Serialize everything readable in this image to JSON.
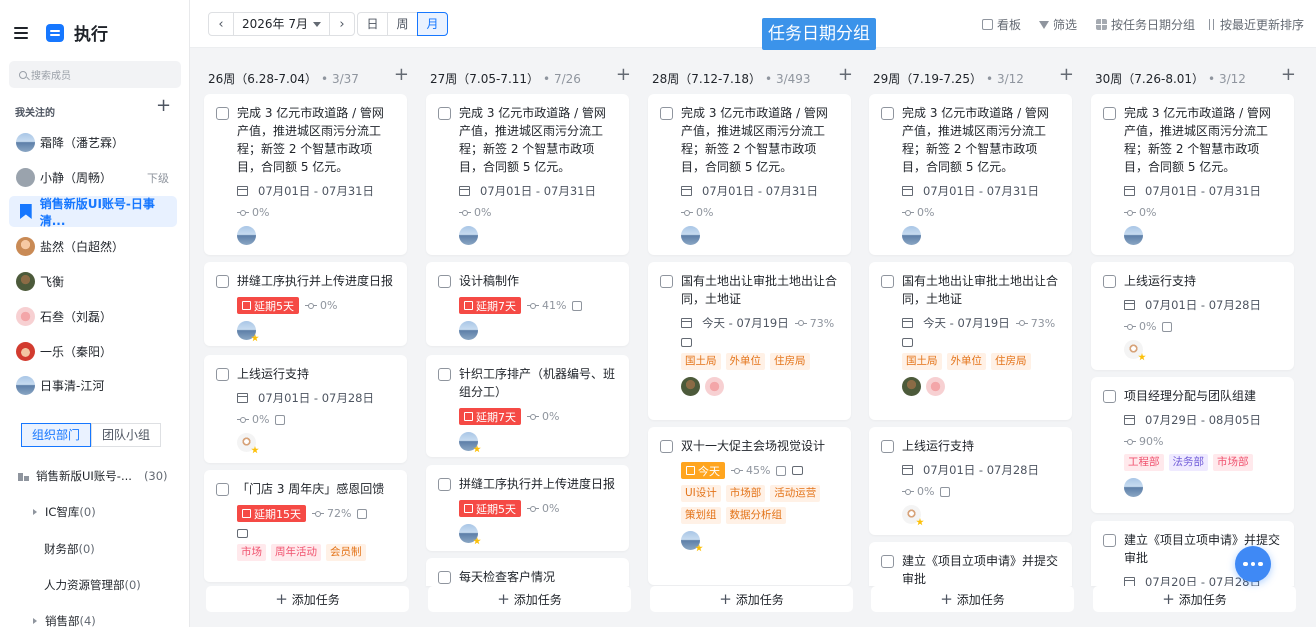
{
  "app": {
    "title": "执行"
  },
  "sidebar": {
    "search_placeholder": "搜索成员",
    "fav_title": "我关注的",
    "fav_add": "+",
    "members": [
      {
        "name": "霜降（潘艺霖）",
        "tag": ""
      },
      {
        "name": "小静（周畅）",
        "tag": "下级"
      },
      {
        "name": "销售新版UI账号-日事清...",
        "tag": ""
      },
      {
        "name": "盐然（白超然）",
        "tag": ""
      },
      {
        "name": "飞衡",
        "tag": ""
      },
      {
        "name": "石叁（刘磊）",
        "tag": ""
      },
      {
        "name": "一乐（秦阳）",
        "tag": ""
      },
      {
        "name": "日事清-江河",
        "tag": ""
      }
    ],
    "tabs": [
      "组织部门",
      "团队小组"
    ],
    "orgs": [
      {
        "name": "销售新版UI账号-...",
        "count": "(30)"
      },
      {
        "name": "IC智库",
        "count": "(0)"
      },
      {
        "name": "财务部",
        "count": "(0)"
      },
      {
        "name": "人力资源管理部",
        "count": "(0)"
      },
      {
        "name": "销售部",
        "count": "(4)"
      }
    ]
  },
  "toolbar": {
    "prev": "‹",
    "month": "2026年 7月",
    "next": "›",
    "views": [
      "日",
      "周",
      "月"
    ],
    "banner": "任务日期分组",
    "actions": [
      "看板",
      "筛选",
      "按任务日期分组",
      "按最近更新排序"
    ]
  },
  "columns": [
    {
      "title": "26周（6.28-7.04）",
      "count": "• 3/37",
      "cards": [
        {
          "title": "完成 3 亿元市政道路 / 管网产值，推进城区雨污分流工程；新签 2 个智慧市政项目，合同额 5 亿元。",
          "date": "07月01日 - 07月31日",
          "progress": "0%"
        },
        {
          "title": "拼缝工序执行并上传进度日报",
          "delay": "延期5天",
          "progress": "0%"
        },
        {
          "title": "上线运行支持",
          "date": "07月01日 - 07月28日",
          "progress": "0%"
        },
        {
          "title": "「门店 3 周年庆」感恩回馈",
          "delay": "延期15天",
          "progress": "72%",
          "labels": [
            "市场",
            "周年活动",
            "会员制"
          ]
        }
      ],
      "add": "添加任务"
    },
    {
      "title": "27周（7.05-7.11）",
      "count": "• 7/26",
      "cards": [
        {
          "title": "完成 3 亿元市政道路 / 管网产值，推进城区雨污分流工程；新签 2 个智慧市政项目，合同额 5 亿元。",
          "date": "07月01日 - 07月31日",
          "progress": "0%"
        },
        {
          "title": "设计稿制作",
          "delay": "延期7天",
          "progress": "41%"
        },
        {
          "title": "针织工序排产（机器编号、班组分工）",
          "delay": "延期7天",
          "progress": "0%"
        },
        {
          "title": "拼缝工序执行并上传进度日报",
          "delay": "延期5天",
          "progress": "0%"
        },
        {
          "title": "每天检查客户情况"
        }
      ],
      "add": "添加任务"
    },
    {
      "title": "28周（7.12-7.18）",
      "count": "• 3/493",
      "cards": [
        {
          "title": "完成 3 亿元市政道路 / 管网产值，推进城区雨污分流工程；新签 2 个智慧市政项目，合同额 5 亿元。",
          "date": "07月01日 - 07月31日",
          "progress": "0%"
        },
        {
          "title": "国有土地出让审批土地出让合同，土地证",
          "date": "今天 - 07月19日",
          "progress": "73%",
          "labels": [
            "国土局",
            "外单位",
            "住房局"
          ]
        },
        {
          "title": "双十一大促主会场视觉设计",
          "today": "今天",
          "progress": "45%",
          "labels": [
            "UI设计",
            "市场部",
            "活动运营",
            "策划组",
            "数据分析组"
          ]
        }
      ],
      "add": "添加任务"
    },
    {
      "title": "29周（7.19-7.25）",
      "count": "• 3/12",
      "cards": [
        {
          "title": "完成 3 亿元市政道路 / 管网产值，推进城区雨污分流工程；新签 2 个智慧市政项目，合同额 5 亿元。",
          "date": "07月01日 - 07月31日",
          "progress": "0%"
        },
        {
          "title": "国有土地出让审批土地出让合同，土地证",
          "date": "今天 - 07月19日",
          "progress": "73%",
          "labels": [
            "国土局",
            "外单位",
            "住房局"
          ]
        },
        {
          "title": "上线运行支持",
          "date": "07月01日 - 07月28日",
          "progress": "0%"
        },
        {
          "title": "建立《项目立项申请》并提交审批"
        }
      ],
      "add": "添加任务"
    },
    {
      "title": "30周（7.26-8.01）",
      "count": "• 3/12",
      "cards": [
        {
          "title": "完成 3 亿元市政道路 / 管网产值，推进城区雨污分流工程；新签 2 个智慧市政项目，合同额 5 亿元。",
          "date": "07月01日 - 07月31日",
          "progress": "0%"
        },
        {
          "title": "上线运行支持",
          "date": "07月01日 - 07月28日",
          "progress": "0%"
        },
        {
          "title": "项目经理分配与团队组建",
          "date": "07月29日 - 08月05日",
          "progress": "90%",
          "labels": [
            "工程部",
            "法务部",
            "市场部"
          ]
        },
        {
          "title": "建立《项目立项申请》并提交审批",
          "date": "07月20日 - 07月28日"
        }
      ],
      "add": "添加任务"
    }
  ]
}
